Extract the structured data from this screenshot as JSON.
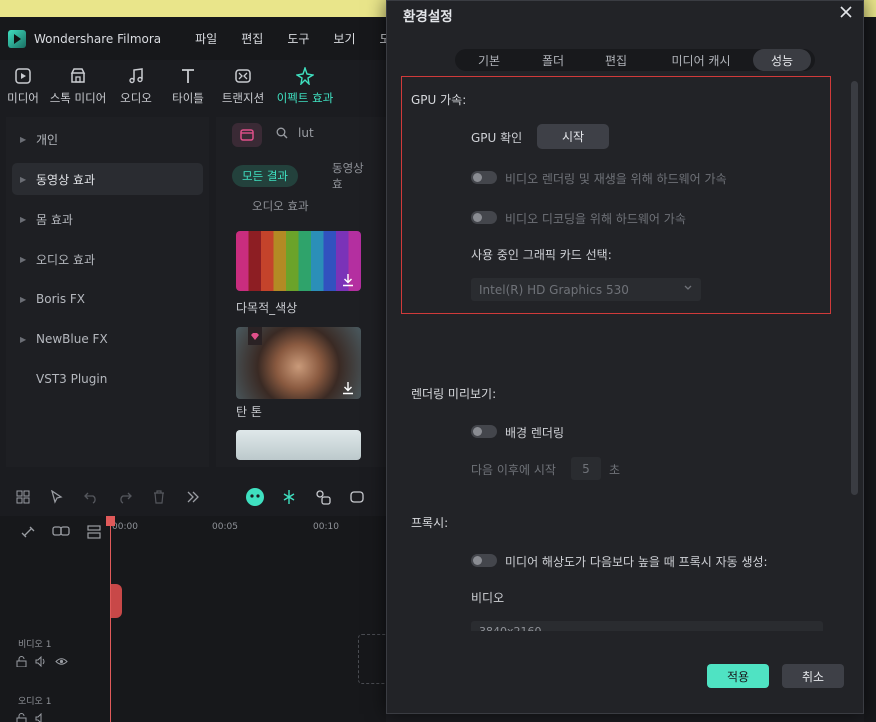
{
  "app": {
    "name": "Wondershare Filmora"
  },
  "menu": [
    "파일",
    "편집",
    "도구",
    "보기",
    "도"
  ],
  "toolbar": {
    "tools": [
      {
        "label": "미디어",
        "icon": "media-icon"
      },
      {
        "label": "스톡 미디어",
        "icon": "stock-media-icon"
      },
      {
        "label": "오디오",
        "icon": "music-note-icon"
      },
      {
        "label": "타이틀",
        "icon": "text-t-icon"
      },
      {
        "label": "트랜지션",
        "icon": "transition-icon"
      },
      {
        "label": "이펙트 효과",
        "icon": "effects-sparkle-icon"
      }
    ]
  },
  "categories": [
    {
      "label": "개인"
    },
    {
      "label": "동영상 효과"
    },
    {
      "label": "몸 효과"
    },
    {
      "label": "오디오 효과"
    },
    {
      "label": "Boris FX"
    },
    {
      "label": "NewBlue FX"
    },
    {
      "label": "VST3 Plugin"
    }
  ],
  "library": {
    "search_value": "lut",
    "filters": {
      "all": "모든 결과",
      "video": "동영상 효",
      "audio": "오디오 효과"
    },
    "items": [
      {
        "label": "다목적_색상"
      },
      {
        "label": "탄 톤"
      }
    ]
  },
  "timeline": {
    "ruler": [
      "00:00",
      "00:05",
      "00:10"
    ],
    "tracks": [
      {
        "label": "비디오 1"
      },
      {
        "label": "오디오 1"
      }
    ]
  },
  "dialog": {
    "title": "환경설정",
    "tabs": [
      "기본",
      "폴더",
      "편집",
      "미디어 캐시",
      "성능"
    ],
    "active_tab": "성능",
    "gpu": {
      "section": "GPU 가속:",
      "check_label": "GPU 확인",
      "start_button": "시작",
      "hw_render": "비디오 렌더링 및 재생을 위해 하드웨어 가속",
      "hw_decode": "비디오 디코딩을 위해 하드웨어 가속",
      "card_label": "사용 중인 그래픽 카드 선택:",
      "card_value": "Intel(R) HD Graphics 530"
    },
    "render_preview": {
      "section": "렌더링 미리보기:",
      "bg_render": "배경 렌더링",
      "start_after": "다음 이후에 시작",
      "seconds_value": "5",
      "seconds_unit": "초"
    },
    "proxy": {
      "section": "프록시:",
      "auto_label": "미디어 해상도가 다음보다 높을 때 프록시 자동 생성:",
      "video_label": "비디오",
      "resolution_value": "3840x2160"
    },
    "ok_button": "적용",
    "cancel_button": "취소"
  }
}
